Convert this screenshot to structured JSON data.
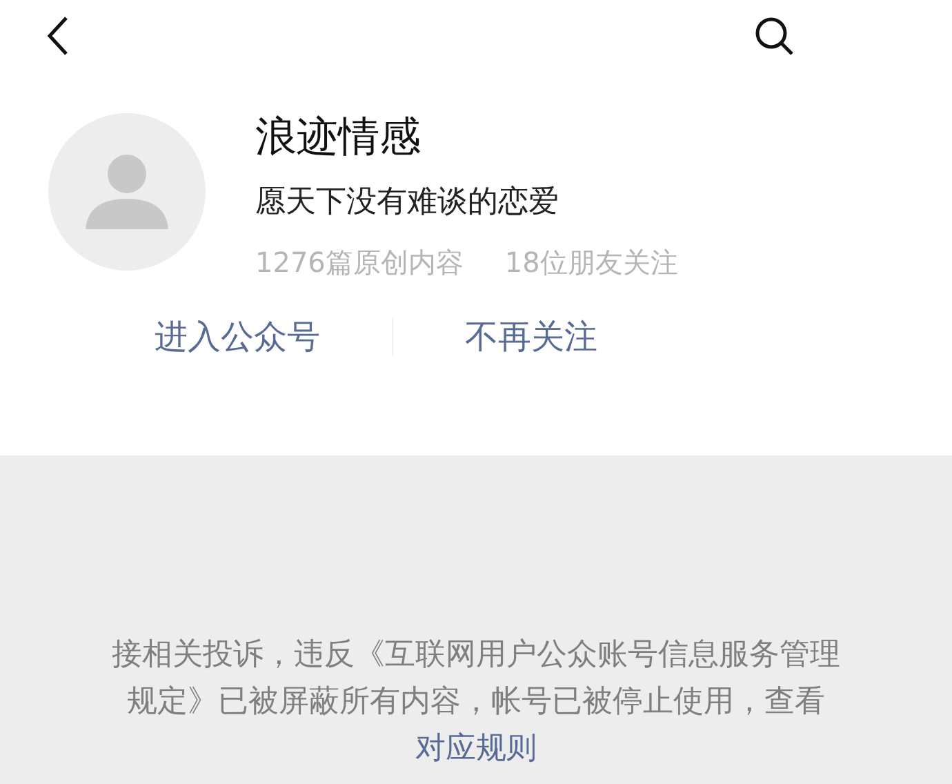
{
  "account": {
    "name": "浪迹情感",
    "signature": "愿天下没有难谈的恋爱",
    "stats": [
      "1276篇原创内容",
      "18位朋友关注"
    ]
  },
  "actions": [
    "进入公众号",
    "不再关注"
  ],
  "notice": {
    "text": "接相关投诉，违反《互联网用户公众账号信息服务管理规定》已被屏蔽所有内容，帐号已被停止使用，查看",
    "link": "对应规则"
  }
}
